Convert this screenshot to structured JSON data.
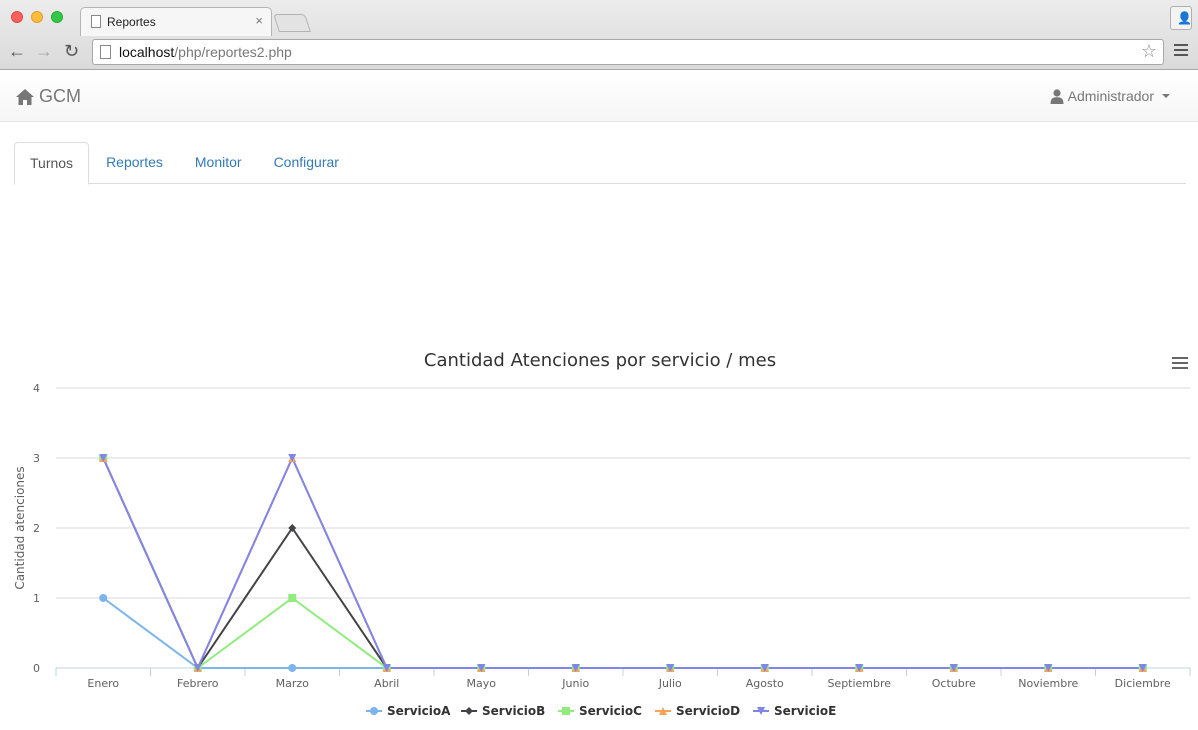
{
  "browser": {
    "tab_title": "Reportes",
    "tab_close": "×",
    "url_host": "localhost",
    "url_path": "/php/reportes2.php",
    "back_icon": "←",
    "forward_icon": "→",
    "reload_icon": "↻",
    "star_icon": "☆"
  },
  "navbar": {
    "brand": "GCM",
    "user": "Administrador"
  },
  "tabs": [
    {
      "label": "Turnos",
      "active": true
    },
    {
      "label": "Reportes",
      "active": false
    },
    {
      "label": "Monitor",
      "active": false
    },
    {
      "label": "Configurar",
      "active": false
    }
  ],
  "chart_data": {
    "type": "line",
    "title": "Cantidad Atenciones por servicio / mes",
    "xlabel": "",
    "ylabel": "Cantidad atenciones",
    "ylim": [
      0,
      4
    ],
    "yticks": [
      0,
      1,
      2,
      3,
      4
    ],
    "grid": true,
    "legend_position": "bottom-center",
    "categories": [
      "Enero",
      "Febrero",
      "Marzo",
      "Abril",
      "Mayo",
      "Junio",
      "Julio",
      "Agosto",
      "Septiembre",
      "Octubre",
      "Noviembre",
      "Diciembre"
    ],
    "series": [
      {
        "name": "ServicioA",
        "color": "#7cb5ec",
        "marker": "circle",
        "values": [
          1,
          0,
          0,
          0,
          0,
          0,
          0,
          0,
          0,
          0,
          0,
          0
        ]
      },
      {
        "name": "ServicioB",
        "color": "#434348",
        "marker": "diamond",
        "values": [
          3,
          0,
          2,
          0,
          0,
          0,
          0,
          0,
          0,
          0,
          0,
          0
        ]
      },
      {
        "name": "ServicioC",
        "color": "#90ed7d",
        "marker": "square",
        "values": [
          3,
          0,
          1,
          0,
          0,
          0,
          0,
          0,
          0,
          0,
          0,
          0
        ]
      },
      {
        "name": "ServicioD",
        "color": "#f7a35c",
        "marker": "triangle",
        "values": [
          3,
          0,
          3,
          0,
          0,
          0,
          0,
          0,
          0,
          0,
          0,
          0
        ]
      },
      {
        "name": "ServicioE",
        "color": "#8085e9",
        "marker": "triangle-down",
        "values": [
          3,
          0,
          3,
          0,
          0,
          0,
          0,
          0,
          0,
          0,
          0,
          0
        ]
      }
    ]
  }
}
